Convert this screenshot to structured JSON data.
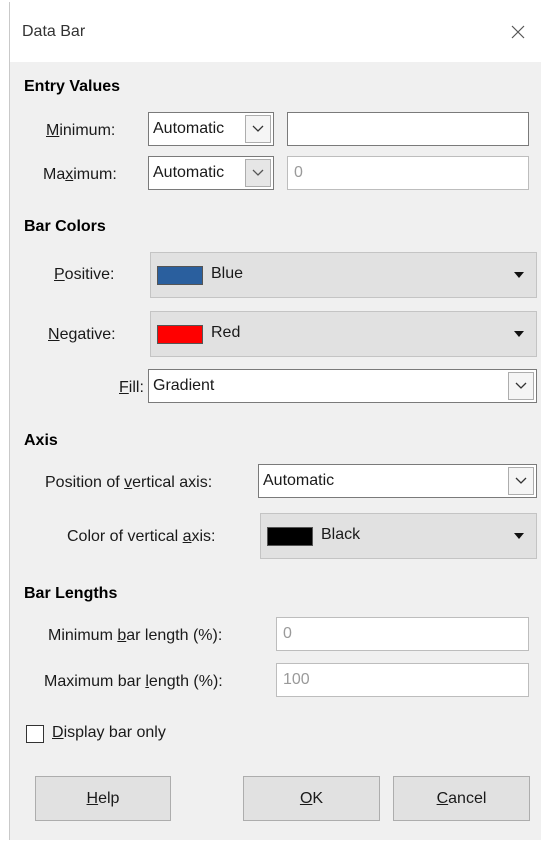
{
  "window": {
    "title": "Data Bar"
  },
  "entry_values": {
    "heading": "Entry Values",
    "minimum": {
      "label_accel": "M",
      "label_rest": "inimum:",
      "mode": "Automatic",
      "value": ""
    },
    "maximum": {
      "label_pre": "Ma",
      "label_accel": "x",
      "label_post": "imum:",
      "mode": "Automatic",
      "value": "0"
    }
  },
  "bar_colors": {
    "heading": "Bar Colors",
    "positive": {
      "label_accel": "P",
      "label_rest": "ositive:",
      "color_name": "Blue",
      "color": "#2a5f9e"
    },
    "negative": {
      "label_accel": "N",
      "label_rest": "egative:",
      "color_name": "Red",
      "color": "#ff0000"
    },
    "fill": {
      "label_accel": "F",
      "label_rest": "ill:",
      "value": "Gradient"
    }
  },
  "axis": {
    "heading": "Axis",
    "position": {
      "label_pre": "Position of ",
      "label_accel": "v",
      "label_post": "ertical axis:",
      "value": "Automatic"
    },
    "color": {
      "label_pre": "Color of vertical ",
      "label_accel": "a",
      "label_post": "xis:",
      "color_name": "Black",
      "color": "#000000"
    }
  },
  "bar_lengths": {
    "heading": "Bar Lengths",
    "min": {
      "label_pre": "Minimum ",
      "label_accel": "b",
      "label_post": "ar length (%):",
      "value": "0"
    },
    "max": {
      "label_pre": "Maximum bar ",
      "label_accel": "l",
      "label_post": "ength (%):",
      "value": "100"
    }
  },
  "display_bar_only": {
    "label_accel": "D",
    "label_rest": "isplay bar only",
    "checked": false
  },
  "buttons": {
    "help": {
      "accel": "H",
      "rest": "elp"
    },
    "ok": {
      "accel": "O",
      "rest": "K"
    },
    "cancel": {
      "accel": "C",
      "rest": "ancel"
    }
  }
}
